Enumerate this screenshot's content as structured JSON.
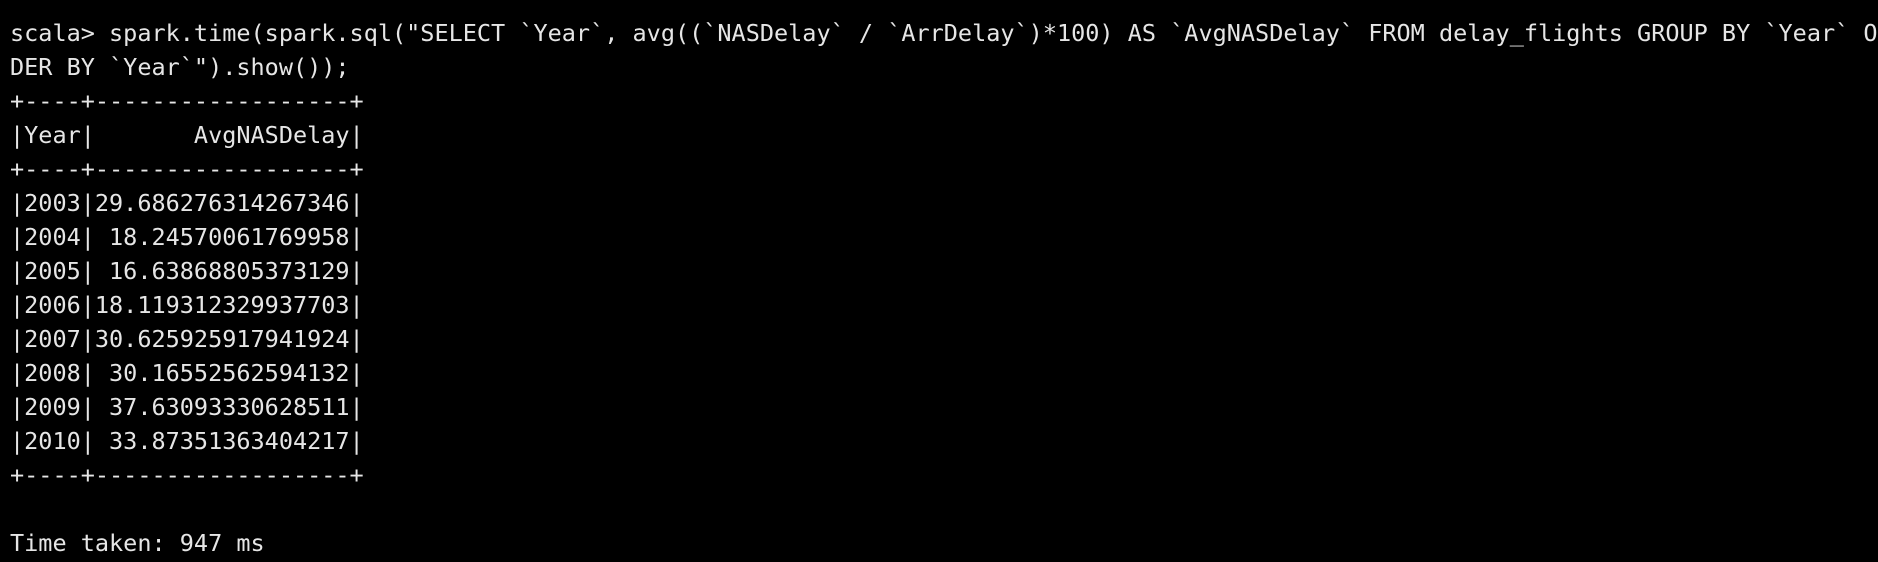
{
  "terminal": {
    "command_line_1": "scala> spark.time(spark.sql(\"SELECT `Year`, avg((`NASDelay` / `ArrDelay`)*100) AS `AvgNASDelay` FROM delay_flights GROUP BY `Year` OR",
    "command_line_2": "DER BY `Year`\").show());",
    "table": {
      "border_top": "+----+------------------+",
      "header_row": "|Year|       AvgNASDelay|",
      "border_header": "+----+------------------+",
      "rows": [
        "|2003|29.686276314267346|",
        "|2004| 18.24570061769958|",
        "|2005| 16.63868805373129|",
        "|2006|18.119312329937703|",
        "|2007|30.625925917941924|",
        "|2008| 30.16552562594132|",
        "|2009| 37.63093330628511|",
        "|2010| 33.87351363404217|"
      ],
      "border_bottom": "+----+------------------+"
    },
    "time_taken": "Time taken: 947 ms"
  }
}
